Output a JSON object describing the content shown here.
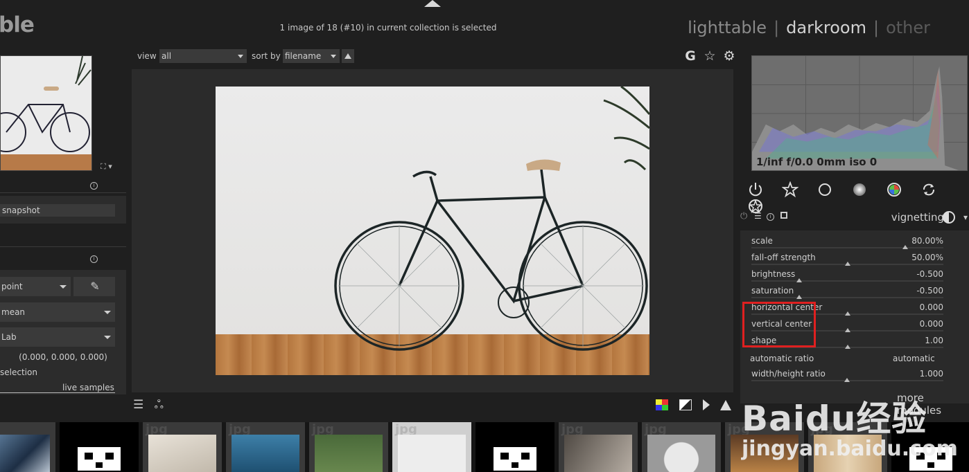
{
  "app_title": "ble",
  "status": {
    "selection": "1 image of 18 (#10) in current collection is selected"
  },
  "views": {
    "lighttable": "lighttable",
    "darkroom": "darkroom",
    "other": "other",
    "separator": "|"
  },
  "left_panel": {
    "snapshot_label": "snapshot",
    "picker": {
      "mode": "point",
      "stat": "mean",
      "colorspace": "Lab",
      "values": "(0.000, 0.000, 0.000)",
      "selection_label": "selection",
      "live_samples": "live samples"
    }
  },
  "toolbar": {
    "view_label": "view",
    "view_value": "all",
    "sort_label": "sort by",
    "sort_value": "filename",
    "icons": [
      "grouping-icon",
      "star-icon",
      "gear-icon"
    ],
    "grouping_glyph": "G",
    "star_glyph": "☆",
    "gear_glyph": "⚙"
  },
  "histogram": {
    "exif": "1/inf f/0.0 0mm iso 0"
  },
  "module": {
    "name": "vignetting",
    "params": [
      {
        "label": "scale",
        "value": "80.00%",
        "level": 0.8
      },
      {
        "label": "fall-off strength",
        "value": "50.00%",
        "level": 0.5
      },
      {
        "label": "brightness",
        "value": "-0.500",
        "level": 0.25
      },
      {
        "label": "saturation",
        "value": "-0.500",
        "level": 0.25
      },
      {
        "label": "horizontal center",
        "value": "0.000",
        "level": 0.5
      },
      {
        "label": "vertical center",
        "value": "0.000",
        "level": 0.5
      },
      {
        "label": "shape",
        "value": "1.00",
        "level": 0.5
      }
    ],
    "automatic_ratio_label": "automatic ratio",
    "automatic_ratio_value": "automatic",
    "width_height_label": "width/height ratio",
    "width_height_value": "1.000",
    "more_modules": "more modules"
  },
  "filmstrip": {
    "tag": "jpg"
  },
  "watermark": {
    "brand": "Baidu经验",
    "url": "jingyan.baidu.com"
  }
}
